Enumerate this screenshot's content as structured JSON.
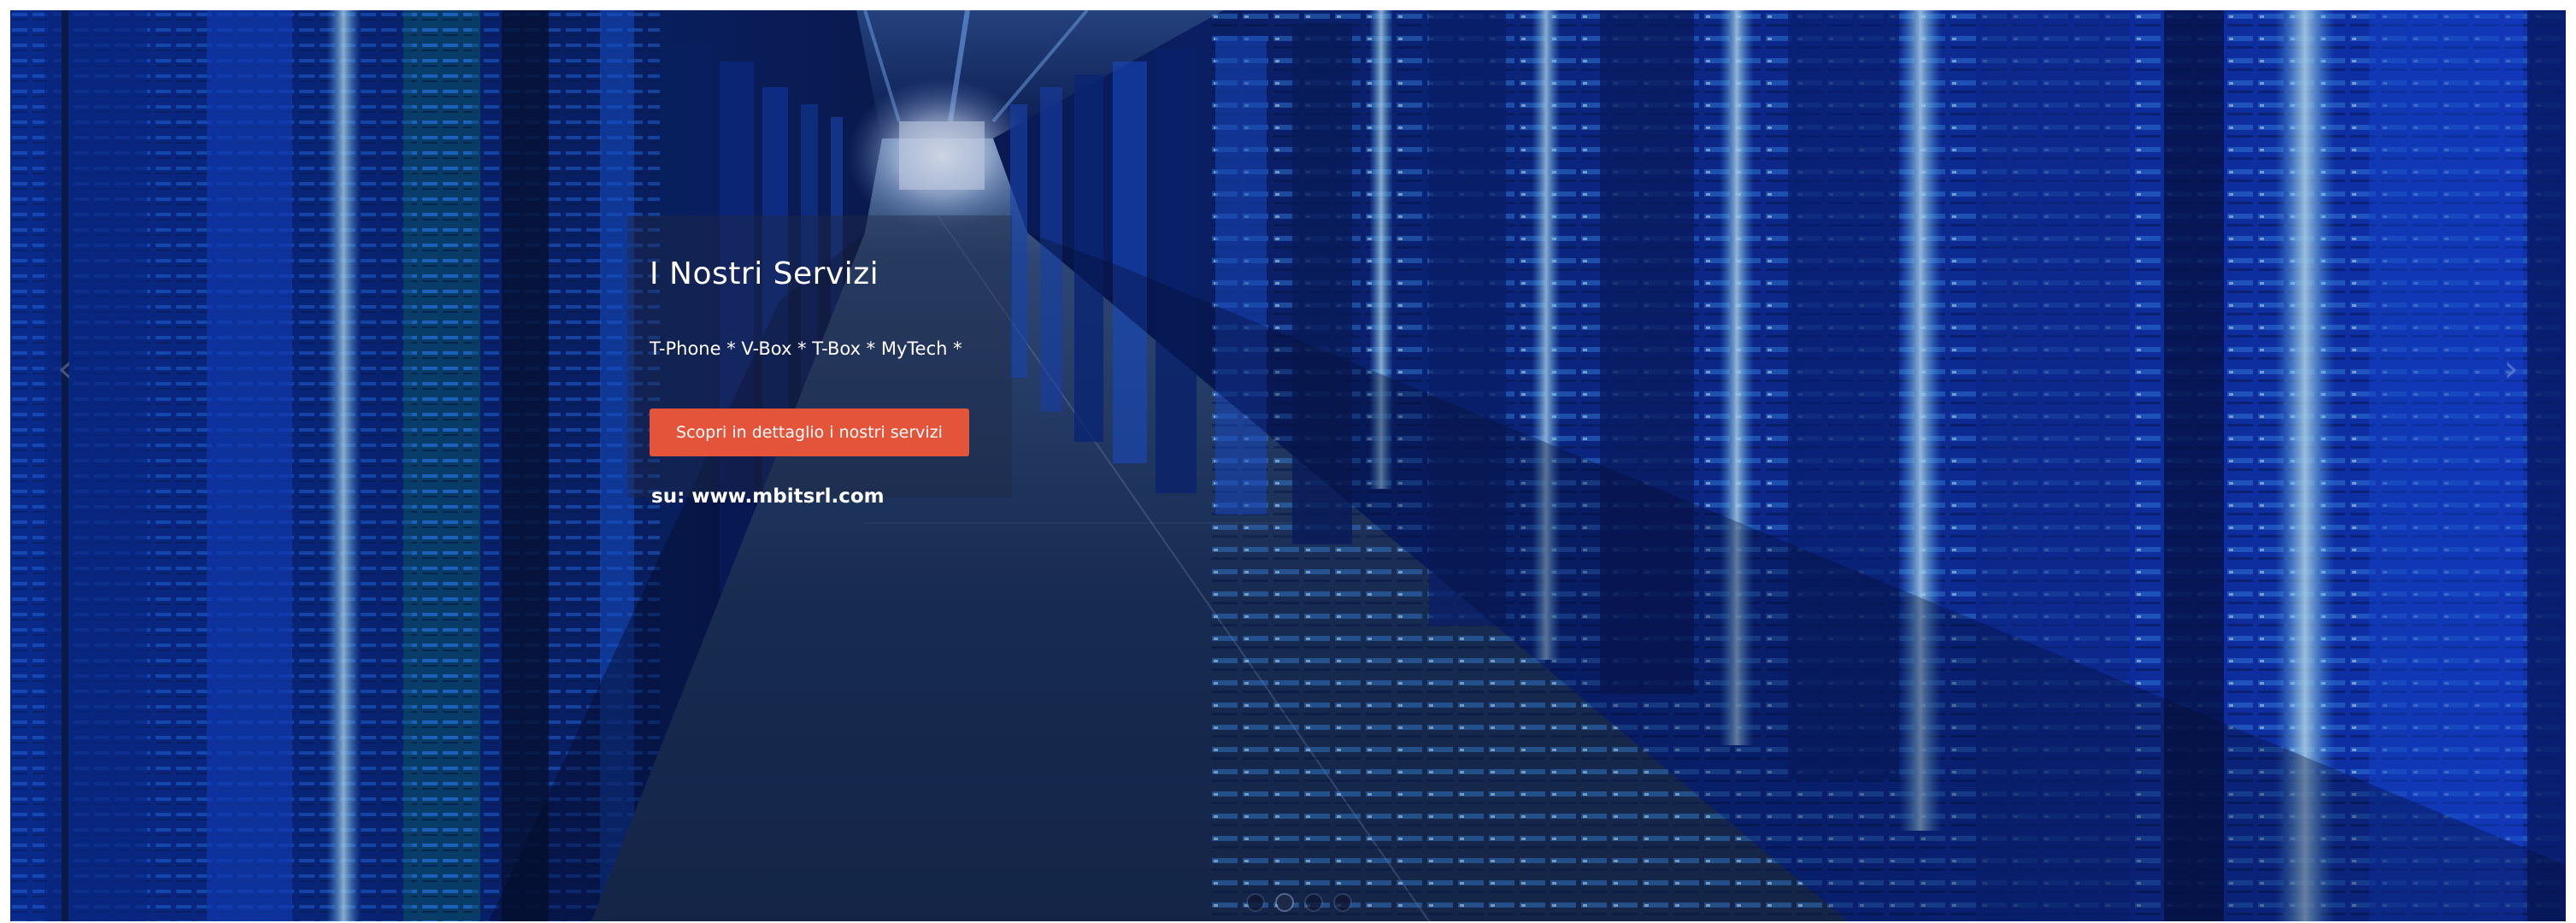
{
  "slider": {
    "background_icon": "datacenter-corridor-photo",
    "caption": {
      "title": "I Nostri Servizi",
      "subtitle": "T-Phone * V-Box * T-Box * MyTech *",
      "button_label": "Scopri in dettaglio i nostri servizi",
      "site_note": "su: www.mbitsrl.com"
    },
    "prev_arrow": "‹",
    "next_arrow": "›",
    "dots": [
      {
        "active": false
      },
      {
        "active": true
      },
      {
        "active": false
      },
      {
        "active": false
      }
    ]
  },
  "colors": {
    "button": "#e4543a",
    "accent_blue": "#1e7bff",
    "background_dark": "#02082a"
  }
}
